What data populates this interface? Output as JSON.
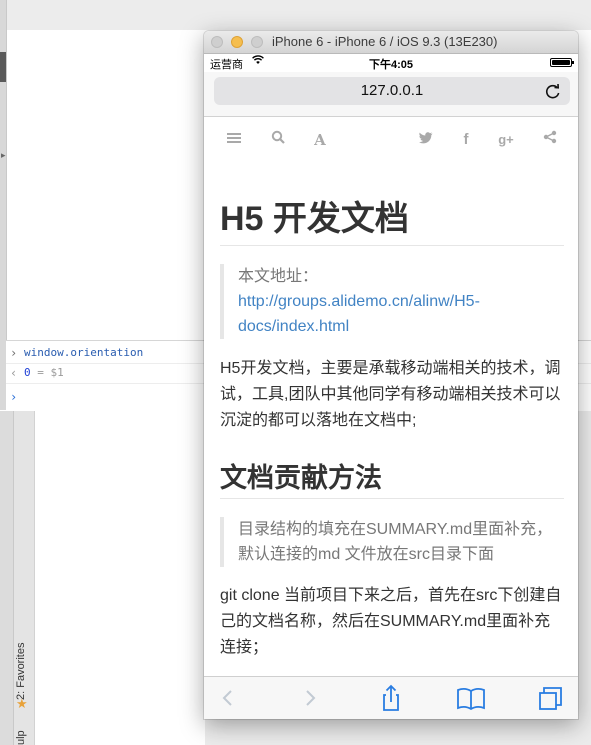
{
  "devtools": {
    "console": {
      "command": "window.orientation",
      "result_value": "0",
      "result_ref": "= $1",
      "input_arrow": "›",
      "output_arrow": "‹",
      "prompt_arrow": "›"
    },
    "sidebar_tab_favorites": "2: Favorites",
    "sidebar_tab_partial": "ulp"
  },
  "simulator": {
    "title": "iPhone 6 - iPhone 6 / iOS 9.3 (13E230)",
    "status": {
      "carrier": "运营商",
      "time": "下午4:05"
    },
    "address": "127.0.0.1",
    "toolbar_icons": [
      "menu-icon",
      "search-icon",
      "font-icon",
      "twitter-icon",
      "facebook-icon",
      "google-plus-icon",
      "share-icon"
    ],
    "page": {
      "h1": "H5 开发文档",
      "quote1_prefix": "本文地址：",
      "quote1_link": "http://groups.alidemo.cn/alinw/H5-docs/index.html",
      "para1": "H5开发文档，主要是承载移动端相关的技术，调试，工具,团队中其他同学有移动端相关技术可以沉淀的都可以落地在文档中;",
      "h2": "文档贡献方法",
      "quote2": "目录结构的填充在SUMMARY.md里面补充，默认连接的md 文件放在src目录下面",
      "para2": "git clone 当前项目下来之后，首先在src下创建自己的文档名称，然后在SUMMARY.md里面补充连接；"
    },
    "bottom_bar": [
      "back-icon",
      "forward-icon",
      "share-icon",
      "bookmarks-icon",
      "tabs-icon"
    ]
  }
}
